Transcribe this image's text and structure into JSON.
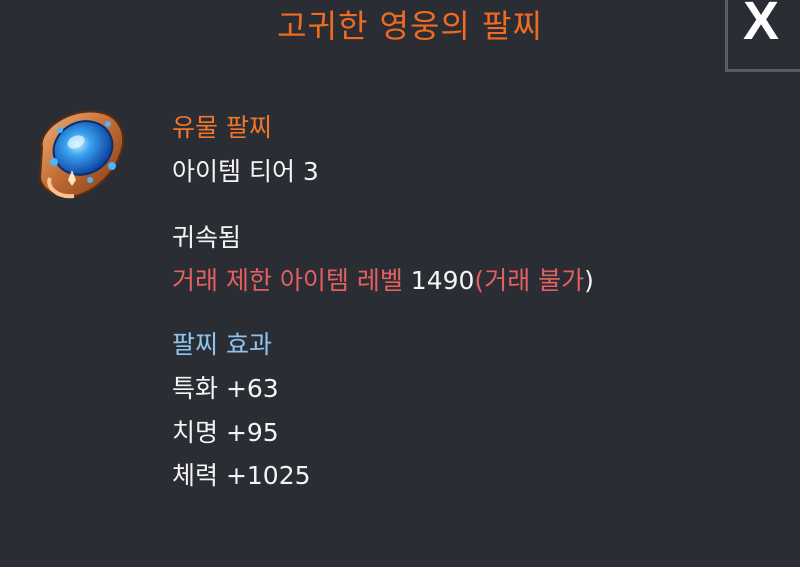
{
  "title": "고귀한 영웅의 팔찌",
  "close": {
    "label": "X"
  },
  "item": {
    "icon": "bracelet-icon",
    "type": "유물 팔찌",
    "tier": "아이템 티어 3"
  },
  "binding": {
    "status": "귀속됨",
    "trade_restriction_label": "거래 제한 아이템 레벨",
    "trade_level": "1490",
    "trade_open_paren": "(",
    "trade_status": "거래 불가",
    "trade_close_paren": ")"
  },
  "effects": {
    "header": "팔찌 효과",
    "stats": [
      {
        "text": "특화 +63"
      },
      {
        "text": "치명 +95"
      },
      {
        "text": "체력 +1025"
      }
    ]
  },
  "colors": {
    "background": "#2b2d34",
    "title": "#f06a21",
    "item_type": "#f0762a",
    "restriction": "#e46060",
    "effect_header": "#8fc3ee",
    "text": "#f4f4f4"
  }
}
